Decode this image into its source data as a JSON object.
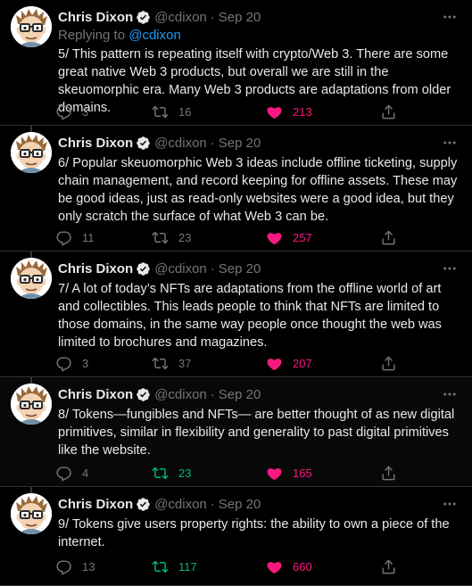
{
  "colors": {
    "background": "#000000",
    "text": "#e7e9ea",
    "muted": "#71767b",
    "link": "#1d9bf0",
    "like": "#f91880",
    "retweet_active": "#00ba7c",
    "verified": "#e7e9ea"
  },
  "author": {
    "name": "Chris Dixon",
    "handle": "@cdixon",
    "verified_icon": "verified-badge-icon",
    "avatar": "cartoon-glasses-avatar"
  },
  "tweets": [
    {
      "date": "Sep 20",
      "replying_label": "Replying to",
      "replying_mention": "@cdixon",
      "text": "5/ This pattern is repeating itself with crypto/Web 3. There are some great native Web 3 products, but overall we are still in the skeuomorphic era. Many Web 3 products are adaptations from older domains.",
      "replies": "3",
      "retweets": "16",
      "likes": "213",
      "retweeted": false,
      "liked": true
    },
    {
      "date": "Sep 20",
      "text": "6/ Popular skeuomorphic Web 3 ideas include offline ticketing, supply chain management, and record keeping for offline assets. These may be good ideas, just as read-only websites were a good idea, but they only scratch the surface of what Web 3 can be.",
      "replies": "11",
      "retweets": "23",
      "likes": "257",
      "retweeted": false,
      "liked": true
    },
    {
      "date": "Sep 20",
      "text": "7/ A lot of today’s NFTs are adaptations from the offline world of art and collectibles. This leads people to think that NFTs are limited to those domains, in the same way people once thought the web was limited to brochures and magazines.",
      "replies": "3",
      "retweets": "37",
      "likes": "207",
      "retweeted": false,
      "liked": true
    },
    {
      "date": "Sep 20",
      "text": "8/ Tokens—fungibles and NFTs— are better thought of as new digital primitives, similar in flexibility and generality to past digital primitives like the website.",
      "replies": "4",
      "retweets": "23",
      "likes": "165",
      "retweeted": true,
      "liked": true
    },
    {
      "date": "Sep 20",
      "text": "9/ Tokens give users property rights: the ability to own a piece of the internet.",
      "replies": "13",
      "retweets": "117",
      "likes": "660",
      "retweeted": true,
      "liked": true
    }
  ],
  "separator": "·"
}
